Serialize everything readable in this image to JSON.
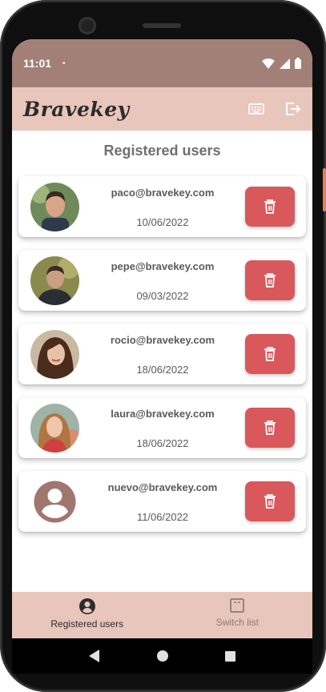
{
  "status_bar": {
    "time": "11:01",
    "dot": "•"
  },
  "app_bar": {
    "brand": "Bravekey",
    "actions": [
      {
        "icon": "keyboard-icon"
      },
      {
        "icon": "logout-icon"
      }
    ]
  },
  "page": {
    "title": "Registered users"
  },
  "users": [
    {
      "email": "paco@bravekey.com",
      "date": "10/06/2022",
      "avatar": "photo-man-1"
    },
    {
      "email": "pepe@bravekey.com",
      "date": "09/03/2022",
      "avatar": "photo-man-2"
    },
    {
      "email": "rocio@bravekey.com",
      "date": "18/06/2022",
      "avatar": "photo-woman-1"
    },
    {
      "email": "laura@bravekey.com",
      "date": "18/06/2022",
      "avatar": "photo-woman-2"
    },
    {
      "email": "nuevo@bravekey.com",
      "date": "11/06/2022",
      "avatar": "default-user-icon"
    }
  ],
  "bottom_nav": {
    "items": [
      {
        "label": "Registered users",
        "icon": "account-circle-icon",
        "active": true
      },
      {
        "label": "Switch list",
        "icon": "switch-list-icon",
        "active": false
      }
    ]
  },
  "colors": {
    "status_bar": "#a28077",
    "app_bar": "#e9c6bb",
    "delete_button": "#d9585b",
    "default_avatar": "#a1766e"
  }
}
